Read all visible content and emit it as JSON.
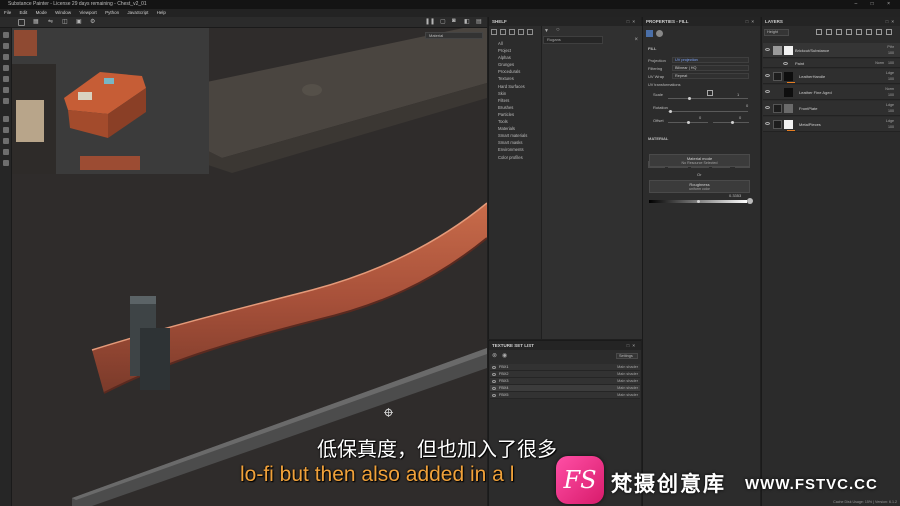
{
  "app": {
    "title": "Substance Painter - License 29 days remaining - Chest_v2_01",
    "window_controls": [
      "–",
      "□",
      "×"
    ]
  },
  "menu": [
    "File",
    "Edit",
    "Mode",
    "Window",
    "Viewport",
    "Python",
    "JavaScript",
    "Help"
  ],
  "viewport": {
    "material_dropdown": "Material"
  },
  "shelf": {
    "title": "SHELF",
    "categories": [
      "All",
      "Project",
      "Alphas",
      "Grunges",
      "Procedurals",
      "Textures",
      "Hard Surfaces",
      "Skin",
      "Filters",
      "Brushes",
      "Particles",
      "Tools",
      "Materials",
      "Smart materials",
      "Smart masks",
      "Environments",
      "Color profiles"
    ],
    "search_placeholder": "Rugans"
  },
  "texture_set_list": {
    "title": "TEXTURE SET LIST",
    "settings_label": "Settings",
    "sets": [
      {
        "name": "FBX1",
        "shader": "Main shader"
      },
      {
        "name": "FBX2",
        "shader": "Main shader"
      },
      {
        "name": "FBX3",
        "shader": "Main shader"
      },
      {
        "name": "FBX4",
        "shader": "Main shader"
      },
      {
        "name": "FBX5",
        "shader": "Main shader"
      }
    ]
  },
  "properties": {
    "title": "PROPERTIES - FILL",
    "section_fill": "FILL",
    "projection_label": "Projection",
    "projection_value": "UV projection",
    "filtering_label": "Filtering",
    "filtering_value": "Bilinear | HQ",
    "uvwrap_label": "UV Wrap",
    "uvwrap_value": "Repeat",
    "uv_transform_label": "UV transformations",
    "scale_label": "Scale",
    "scale_value": "1",
    "rotation_label": "Rotation",
    "rotation_value": "0",
    "offset_label": "Offset",
    "offset_value_1": "0",
    "offset_value_2": "0",
    "section_material": "MATERIAL",
    "channels": [
      "color",
      "height",
      "rough",
      "metal",
      "nrm"
    ],
    "material_mode_label": "Material mode",
    "material_mode_sub": "No Resource Selected",
    "or_label": "Or",
    "roughness_label": "Roughness",
    "roughness_sub": "uniform color",
    "roughness_value": "0.3353"
  },
  "layers": {
    "title": "LAYERS",
    "blend_mode": "Height",
    "rows": [
      {
        "name": "Brickcut/Substance",
        "blend": "Pthr",
        "opacity": "100"
      },
      {
        "name": "Paint",
        "blend": "Norm",
        "opacity": "100"
      },
      {
        "name": "LeatherHandle",
        "blend": "Ldge",
        "opacity": "100"
      },
      {
        "name": "Leather Fine Aged",
        "blend": "Norm",
        "opacity": "100"
      },
      {
        "name": "FrontPlate",
        "blend": "Ldge",
        "opacity": "100"
      },
      {
        "name": "MetalPieces",
        "blend": "Ldge",
        "opacity": "100"
      }
    ]
  },
  "status_bar": "Cache Disk Usage: 15% | Version: 6.1.2",
  "subtitles": {
    "chinese": "低保真度，但也加入了很多",
    "english": "lo-fi but then also added in a l"
  },
  "watermark": {
    "logo_letters": "FS",
    "text": "梵摄创意库",
    "url": "WWW.FSTVC.CC"
  },
  "colors": {
    "accent_blue": "#7fa7ff",
    "subtitle_orange": "#f0a13a",
    "watermark_pink": "#e62a85",
    "leather_brick": "#b4573c"
  }
}
